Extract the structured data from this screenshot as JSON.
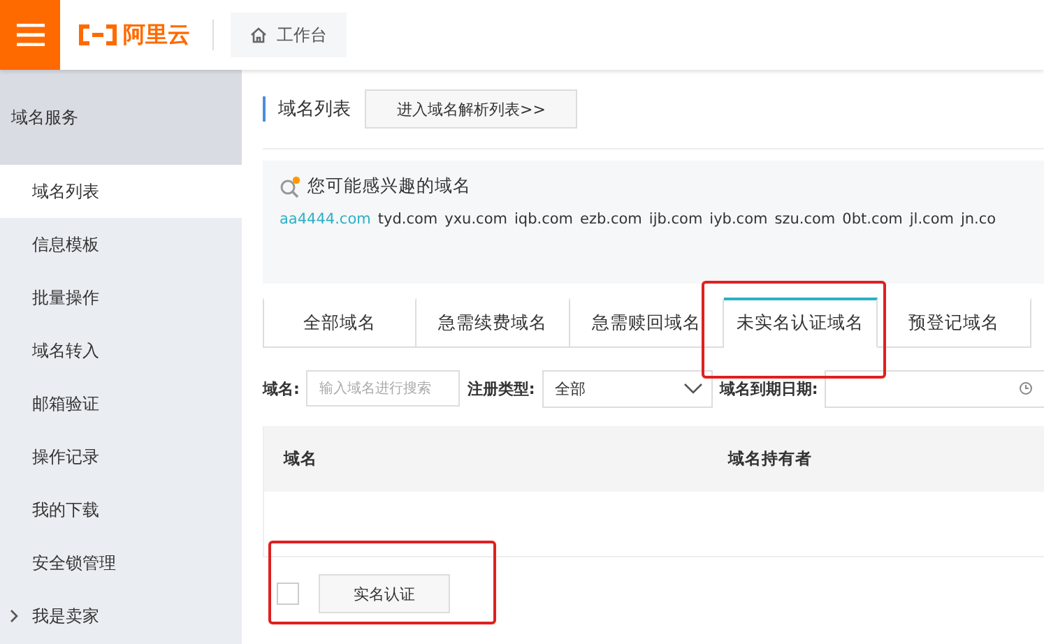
{
  "topbar": {
    "logo": "阿里云",
    "workbench": "工作台"
  },
  "sidebar": {
    "title": "域名服务",
    "items": [
      {
        "label": "域名列表",
        "selected": true
      },
      {
        "label": "信息模板",
        "selected": false
      },
      {
        "label": "批量操作",
        "selected": false
      },
      {
        "label": "域名转入",
        "selected": false
      },
      {
        "label": "邮箱验证",
        "selected": false
      },
      {
        "label": "操作记录",
        "selected": false
      },
      {
        "label": "我的下载",
        "selected": false
      },
      {
        "label": "安全锁管理",
        "selected": false
      },
      {
        "label": "我是卖家",
        "selected": false
      }
    ]
  },
  "header": {
    "title": "域名列表",
    "button": "进入域名解析列表>>"
  },
  "suggestions": {
    "title": "您可能感兴趣的域名",
    "domains": [
      {
        "label": "aa4444.com",
        "selected": true
      },
      {
        "label": "tyd.com",
        "selected": false
      },
      {
        "label": "yxu.com",
        "selected": false
      },
      {
        "label": "iqb.com",
        "selected": false
      },
      {
        "label": "ezb.com",
        "selected": false
      },
      {
        "label": "ijb.com",
        "selected": false
      },
      {
        "label": "iyb.com",
        "selected": false
      },
      {
        "label": "szu.com",
        "selected": false
      },
      {
        "label": "0bt.com",
        "selected": false
      },
      {
        "label": "jl.com",
        "selected": false
      },
      {
        "label": "jn.co",
        "selected": false
      }
    ]
  },
  "tabs": [
    {
      "label": "全部域名",
      "selected": false
    },
    {
      "label": "急需续费域名",
      "selected": false
    },
    {
      "label": "急需赎回域名",
      "selected": false
    },
    {
      "label": "未实名认证域名",
      "selected": true
    },
    {
      "label": "预登记域名",
      "selected": false
    }
  ],
  "filters": {
    "domain_label": "域名:",
    "domain_placeholder": "输入域名进行搜索",
    "type_label": "注册类型:",
    "type_value": "全部",
    "date_label": "域名到期日期:"
  },
  "table": {
    "columns": [
      "域名",
      "域名持有者"
    ]
  },
  "footer": {
    "checked": false,
    "button": "实名认证"
  }
}
